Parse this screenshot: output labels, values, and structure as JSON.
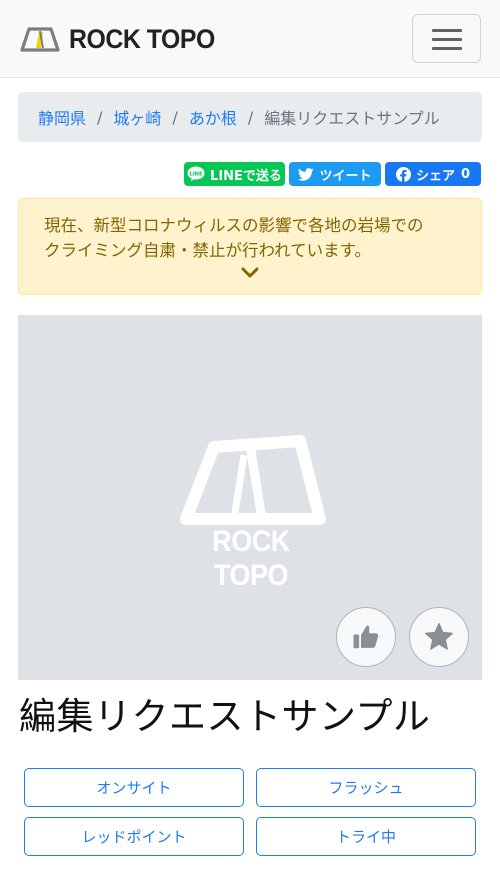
{
  "header": {
    "brand_name": "ROCK TOPO",
    "menu_icon": "hamburger-menu-icon"
  },
  "breadcrumb": {
    "items": [
      "静岡県",
      "城ヶ崎",
      "あか根"
    ],
    "current": "編集リクエストサンプル",
    "separator": "/"
  },
  "share": {
    "line_label": "LINEで送る",
    "tweet_label": "ツイート",
    "facebook_label": "シェア",
    "facebook_count": "0",
    "line_icon": "line-icon",
    "twitter_icon": "twitter-bird-icon",
    "facebook_icon": "facebook-icon"
  },
  "notice": {
    "line1": "現在、新型コロナウィルスの影響で各地の岩場での",
    "line2": "クライミング自粛・禁止が行われています。",
    "expand_icon": "chevron-down-icon"
  },
  "photo": {
    "placeholder_logo_text": "ROCK TOPO",
    "like_icon": "thumbs-up-icon",
    "favorite_icon": "star-icon"
  },
  "problem": {
    "title": "編集リクエストサンプル"
  },
  "status_buttons": [
    "オンサイト",
    "フラッシュ",
    "レッドポイント",
    "トライ中"
  ],
  "colors": {
    "link": "#1e7bf2",
    "line_green": "#06c755",
    "twitter_blue": "#1d9bf0",
    "facebook_blue": "#1877f2",
    "alert_bg": "#fff3cd",
    "alert_text": "#856404",
    "logo_yellow": "#f5d000"
  }
}
